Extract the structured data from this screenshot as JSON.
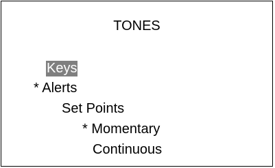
{
  "screen": {
    "title": "TONES",
    "menu": [
      {
        "label": "Keys",
        "selected": true
      },
      {
        "label": "* Alerts",
        "selected": false
      },
      {
        "label": "Set Points",
        "selected": false
      },
      {
        "label": "* Momentary",
        "selected": false
      },
      {
        "label": "Continuous",
        "selected": false
      }
    ],
    "colors": {
      "highlight_background": "#7f7f7f",
      "highlight_text": "#ffffff",
      "text": "#000000",
      "background": "#ffffff"
    }
  }
}
